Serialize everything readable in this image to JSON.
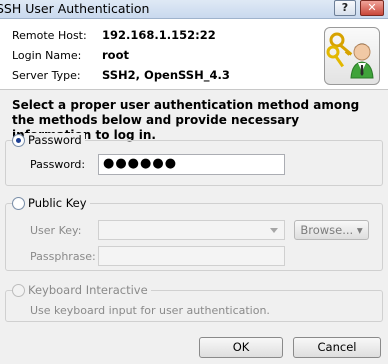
{
  "window": {
    "title": "SSH User Authentication",
    "help_label": "?",
    "close_label": "✕"
  },
  "header": {
    "remote_host_label": "Remote Host:",
    "remote_host_value": "192.168.1.152:22",
    "login_name_label": "Login Name:",
    "login_name_value": "root",
    "server_type_label": "Server Type:",
    "server_type_value": "SSH2, OpenSSH_4.3",
    "icon": "keys-user-icon"
  },
  "instructions": "Select a proper user authentication method among the methods below and provide necessary information to log in.",
  "password_method": {
    "label": "Password",
    "selected": true,
    "field_label": "Password:",
    "field_value": "●●●●●●"
  },
  "publickey_method": {
    "label": "Public Key",
    "selected": false,
    "user_key_label": "User Key:",
    "user_key_value": "",
    "browse_label": "Browse... ▾",
    "passphrase_label": "Passphrase:",
    "passphrase_value": ""
  },
  "keyboard_method": {
    "label": "Keyboard Interactive",
    "selected": false,
    "description": "Use keyboard input for user authentication."
  },
  "footer": {
    "ok_label": "OK",
    "cancel_label": "Cancel"
  }
}
